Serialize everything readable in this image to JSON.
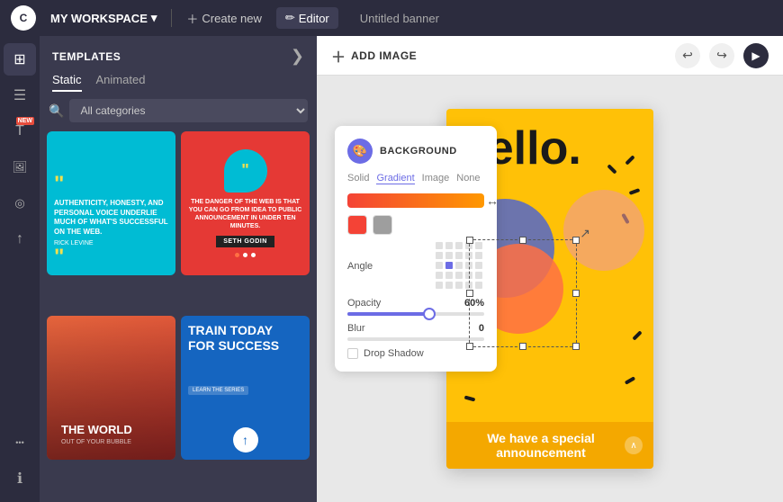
{
  "topbar": {
    "workspace_label": "MY WORKSPACE",
    "create_label": "Create new",
    "editor_label": "Editor",
    "title": "Untitled banner"
  },
  "sidebar": {
    "items": [
      {
        "name": "templates",
        "icon": "⊞",
        "label": "Templates"
      },
      {
        "name": "elements",
        "icon": "☰",
        "label": "Elements"
      },
      {
        "name": "text",
        "icon": "T",
        "label": "Text",
        "badge": "NEW"
      },
      {
        "name": "photos",
        "icon": "🖼",
        "label": "Photos"
      },
      {
        "name": "brand",
        "icon": "◎",
        "label": "Brand"
      },
      {
        "name": "upload",
        "icon": "↑",
        "label": "Upload"
      },
      {
        "name": "more",
        "icon": "•••",
        "label": "More"
      },
      {
        "name": "info",
        "icon": "ℹ",
        "label": "Info"
      }
    ]
  },
  "templates_panel": {
    "title": "TEMPLATES",
    "close_label": "❯",
    "tabs": [
      {
        "label": "Static",
        "active": true
      },
      {
        "label": "Animated",
        "active": false
      }
    ],
    "search_placeholder": "All categories",
    "cards": [
      {
        "id": "tpl1",
        "type": "quote-cyan"
      },
      {
        "id": "tpl2",
        "type": "quote-red"
      },
      {
        "id": "tpl3",
        "type": "world"
      },
      {
        "id": "tpl4",
        "type": "train"
      }
    ]
  },
  "tpl1": {
    "text": "AUTHENTICITY, HONESTY, AND PERSONAL VOICE UNDERLIE MUCH OF WHAT'S SUCCESSFUL ON THE WEB.",
    "author": "RICK LEVINE"
  },
  "tpl2": {
    "text": "THE DANGER OF THE WEB IS THAT YOU CAN GO FROM IDEA TO PUBLIC ANNOUNCEMENT IN UNDER TEN MINUTES.",
    "author": "SETH GODIN"
  },
  "tpl3": {
    "title": "THE WORLD",
    "subtitle": "OUT OF YOUR BUBBLE"
  },
  "tpl4": {
    "title": "TRAIN TODAY FOR SUCCESS",
    "link": "LEARN THE SERIES"
  },
  "toolbar": {
    "add_image_label": "ADD IMAGE",
    "undo_icon": "↩",
    "redo_icon": "↪",
    "play_icon": "▶"
  },
  "bg_panel": {
    "title": "BACKGROUND",
    "tabs": [
      "Solid",
      "Gradient",
      "Image",
      "None"
    ],
    "active_tab": "Gradient",
    "opacity_label": "Opacity",
    "opacity_value": "60%",
    "blur_label": "Blur",
    "blur_value": "0",
    "angle_label": "Angle",
    "drop_shadow_label": "Drop Shadow"
  },
  "banner": {
    "hello_text": "hello.",
    "announcement_text": "We have a special announcement"
  }
}
